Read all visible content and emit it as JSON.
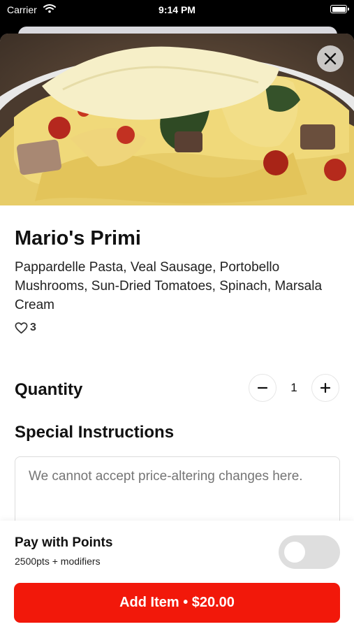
{
  "status_bar": {
    "carrier": "Carrier",
    "time": "9:14 PM"
  },
  "item": {
    "title": "Mario's Primi",
    "description": "Pappardelle Pasta, Veal Sausage, Portobello Mushrooms, Sun-Dried Tomatoes, Spinach, Marsala Cream",
    "likes": "3"
  },
  "quantity": {
    "label": "Quantity",
    "value": "1"
  },
  "instructions": {
    "label": "Special Instructions",
    "placeholder": "We cannot accept price-altering changes here."
  },
  "points": {
    "title": "Pay with Points",
    "subtitle": "2500pts + modifiers",
    "enabled": false
  },
  "add_button": {
    "label": "Add Item • $20.00"
  },
  "colors": {
    "accent": "#f2180a",
    "toggle_off": "#dedede"
  },
  "icons": {
    "close": "close-icon",
    "heart": "heart-icon",
    "minus": "minus-icon",
    "plus": "plus-icon",
    "wifi": "wifi-icon",
    "battery": "battery-icon"
  }
}
